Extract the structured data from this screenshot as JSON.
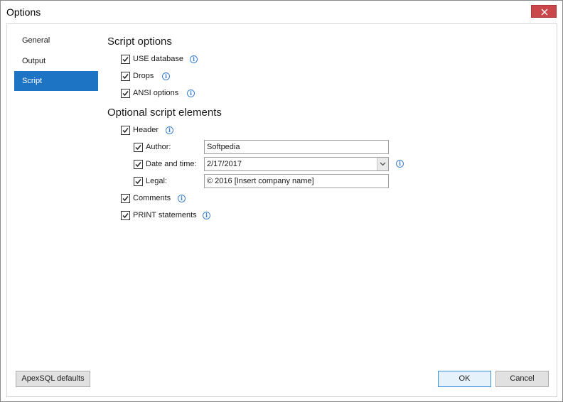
{
  "window": {
    "title": "Options"
  },
  "nav": {
    "items": [
      {
        "label": "General"
      },
      {
        "label": "Output"
      },
      {
        "label": "Script"
      }
    ]
  },
  "script_options": {
    "heading": "Script options",
    "use_database": {
      "label": "USE database",
      "checked": true
    },
    "drops": {
      "label": "Drops",
      "checked": true
    },
    "ansi_options": {
      "label": "ANSI options",
      "checked": true
    }
  },
  "optional_elements": {
    "heading": "Optional script elements",
    "header": {
      "label": "Header",
      "checked": true
    },
    "author": {
      "label": "Author:",
      "checked": true,
      "value": "Softpedia"
    },
    "date_time": {
      "label": "Date and time:",
      "checked": true,
      "value": "2/17/2017"
    },
    "legal": {
      "label": "Legal:",
      "checked": true,
      "value": "© 2016 [Insert company name]"
    },
    "comments": {
      "label": "Comments",
      "checked": true
    },
    "print_statements": {
      "label": "PRINT statements",
      "checked": true
    }
  },
  "footer": {
    "defaults_label": "ApexSQL defaults",
    "ok_label": "OK",
    "cancel_label": "Cancel"
  },
  "colors": {
    "accent": "#1d73c4",
    "close": "#c9474a",
    "info": "#3b7fd0"
  }
}
